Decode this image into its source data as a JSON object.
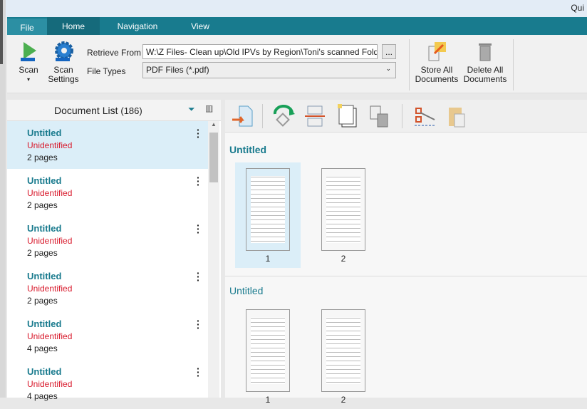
{
  "title": "Qui",
  "tabs": [
    "File",
    "Home",
    "Navigation",
    "View"
  ],
  "ribbon": {
    "scan": "Scan",
    "scan_settings_1": "Scan",
    "scan_settings_2": "Settings",
    "retrieve_label": "Retrieve From",
    "retrieve_value": "W:\\Z Files- Clean up\\Old IPVs by Region\\Toni's scanned Folde",
    "browse": "...",
    "types_label": "File Types",
    "types_value": "PDF Files (*.pdf)",
    "store_1": "Store All",
    "store_2": "Documents",
    "delete_1": "Delete All",
    "delete_2": "Documents"
  },
  "doclist": {
    "title": "Document List",
    "count": "(186)",
    "items": [
      {
        "name": "Untitled",
        "status": "Unidentified",
        "pages": "2 pages"
      },
      {
        "name": "Untitled",
        "status": "Unidentified",
        "pages": "2 pages"
      },
      {
        "name": "Untitled",
        "status": "Unidentified",
        "pages": "2 pages"
      },
      {
        "name": "Untitled",
        "status": "Unidentified",
        "pages": "2 pages"
      },
      {
        "name": "Untitled",
        "status": "Unidentified",
        "pages": "4 pages"
      },
      {
        "name": "Untitled",
        "status": "Unidentified",
        "pages": "4 pages"
      }
    ]
  },
  "viewer": {
    "groups": [
      {
        "title": "Untitled",
        "pages": [
          "1",
          "2"
        ]
      },
      {
        "title": "Untitled",
        "pages": [
          "1",
          "2"
        ]
      }
    ]
  }
}
